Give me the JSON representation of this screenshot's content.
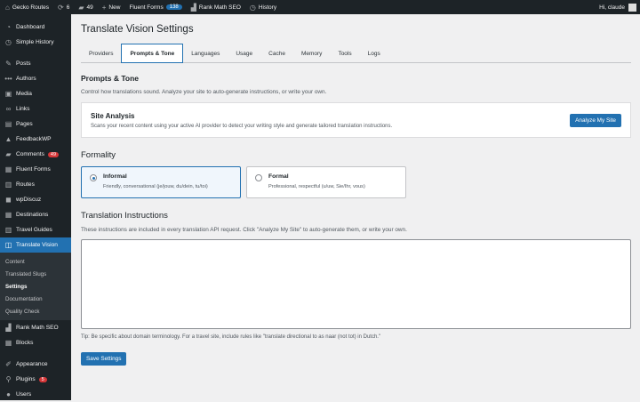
{
  "adminbar": {
    "site": "Gecko Routes",
    "updates": "6",
    "comments": "49",
    "new": "New",
    "fluent_forms": "Fluent Forms",
    "fluent_badge": "138",
    "rank_math": "Rank Math SEO",
    "history": "History",
    "greeting": "Hi, claude"
  },
  "sidebar": {
    "items": [
      {
        "label": "Dashboard",
        "icon": "gauge-icon"
      },
      {
        "label": "Simple History",
        "icon": "history-icon"
      },
      {
        "label": "Posts",
        "icon": "pin-icon"
      },
      {
        "label": "Authors",
        "icon": "dots-icon"
      },
      {
        "label": "Media",
        "icon": "media-icon"
      },
      {
        "label": "Links",
        "icon": "link-icon"
      },
      {
        "label": "Pages",
        "icon": "page-icon"
      },
      {
        "label": "FeedbackWP",
        "icon": "thumb-icon"
      },
      {
        "label": "Comments",
        "icon": "comment-icon",
        "badge": "49"
      },
      {
        "label": "Fluent Forms",
        "icon": "form-icon"
      },
      {
        "label": "Routes",
        "icon": "route-icon"
      },
      {
        "label": "wpDiscuz",
        "icon": "discuz-icon"
      },
      {
        "label": "Destinations",
        "icon": "destination-icon"
      },
      {
        "label": "Travel Guides",
        "icon": "book-icon"
      },
      {
        "label": "Translate Vision",
        "icon": "translate-icon"
      }
    ],
    "submenu": [
      "Content",
      "Translated Slugs",
      "Settings",
      "Documentation",
      "Quality Check"
    ],
    "items2": [
      {
        "label": "Rank Math SEO",
        "icon": "chart-icon"
      },
      {
        "label": "Blocks",
        "icon": "blocks-icon"
      },
      {
        "label": "Appearance",
        "icon": "brush-icon"
      },
      {
        "label": "Plugins",
        "icon": "plugin-icon",
        "badge": "5"
      },
      {
        "label": "Users",
        "icon": "user-icon"
      }
    ]
  },
  "page": {
    "title": "Translate Vision Settings",
    "tabs": [
      "Providers",
      "Prompts & Tone",
      "Languages",
      "Usage",
      "Cache",
      "Memory",
      "Tools",
      "Logs"
    ],
    "active_tab": "Prompts & Tone",
    "section_title": "Prompts & Tone",
    "section_desc": "Control how translations sound. Analyze your site to auto-generate instructions, or write your own.",
    "analysis": {
      "title": "Site Analysis",
      "desc": "Scans your recent content using your active AI provider to detect your writing style and generate tailored translation instructions.",
      "button": "Analyze My Site"
    },
    "formality": {
      "title": "Formality",
      "options": [
        {
          "label": "Informal",
          "desc": "Friendly, conversational (je/jouw, du/dein, tu/toi)",
          "selected": true
        },
        {
          "label": "Formal",
          "desc": "Professional, respectful (u/uw, Sie/Ihr, vous)",
          "selected": false
        }
      ]
    },
    "instructions": {
      "title": "Translation Instructions",
      "desc": "These instructions are included in every translation API request. Click \"Analyze My Site\" to auto-generate them, or write your own.",
      "value": "",
      "tip": "Tip: Be specific about domain terminology. For a travel site, include rules like \"translate directional to as naar (not tot) in Dutch.\""
    },
    "save": "Save Settings"
  },
  "colors": {
    "accent": "#2271b1",
    "sidebar": "#1d2327",
    "badge": "#d63638"
  }
}
